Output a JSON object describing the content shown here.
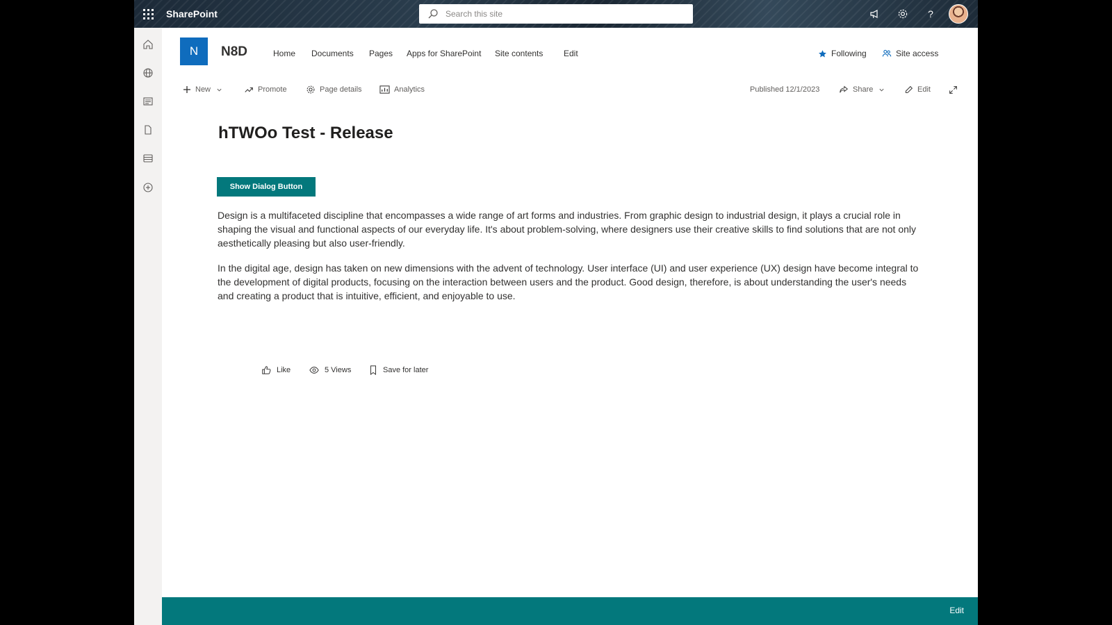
{
  "suite": {
    "app_name": "SharePoint",
    "search_placeholder": "Search this site"
  },
  "site": {
    "logo_letter": "N",
    "title": "N8D",
    "nav": [
      "Home",
      "Documents",
      "Pages",
      "Apps for SharePoint",
      "Site contents",
      "Edit"
    ],
    "following_label": "Following",
    "site_access_label": "Site access"
  },
  "commandbar": {
    "new_label": "New",
    "promote_label": "Promote",
    "page_details_label": "Page details",
    "analytics_label": "Analytics",
    "published_label": "Published 12/1/2023",
    "share_label": "Share",
    "edit_label": "Edit"
  },
  "page": {
    "title": "hTWOo Test - Release",
    "dialog_button_label": "Show Dialog Button",
    "paragraphs": [
      "Design is a multifaceted discipline that encompasses a wide range of art forms and industries. From graphic design to industrial design, it plays a crucial role in shaping the visual and functional aspects of our everyday life. It's about problem-solving, where designers use their creative skills to find solutions that are not only aesthetically pleasing but also user-friendly.",
      "In the digital age, design has taken on new dimensions with the advent of technology. User interface (UI) and user experience (UX) design have become integral to the development of digital products, focusing on the interaction between users and the product. Good design, therefore, is about understanding the user's needs and creating a product that is intuitive, efficient, and enjoyable to use."
    ]
  },
  "social": {
    "like_label": "Like",
    "views_label": "5 Views",
    "save_label": "Save for later"
  },
  "footer": {
    "edit_label": "Edit"
  },
  "colors": {
    "theme": "#03787c",
    "logo": "#0f6cbd"
  }
}
